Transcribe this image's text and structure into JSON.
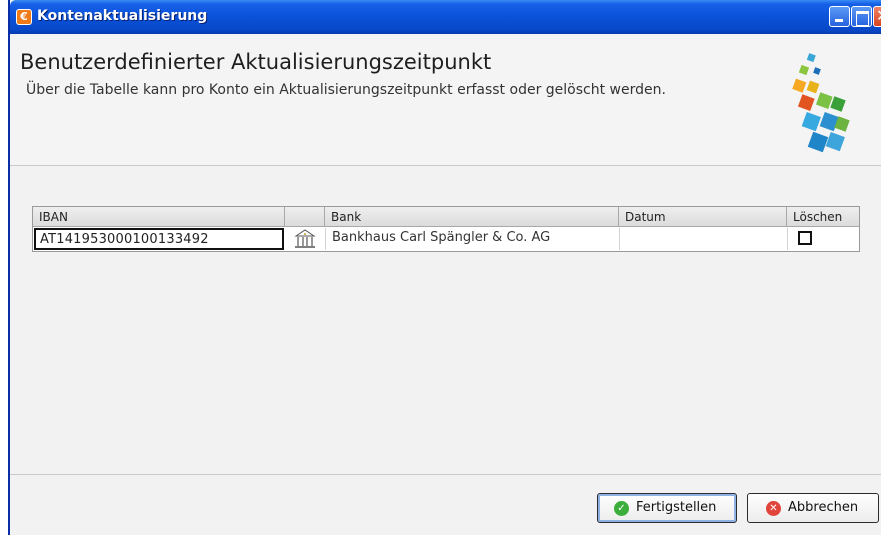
{
  "window": {
    "title": "Kontenaktualisierung",
    "app_icon": "euro-icon",
    "controls": [
      "minimize-icon",
      "maximize-icon",
      "close-icon"
    ]
  },
  "header": {
    "title": "Benutzerdefinierter Aktualisierungszeitpunkt",
    "description": "Über die Tabelle kann pro Konto ein Aktualisierungszeitpunkt erfasst oder gelöscht werden.",
    "decoration_icon": "colored-cubes-icon"
  },
  "table": {
    "columns": [
      "IBAN",
      "",
      "Bank",
      "Datum",
      "Löschen"
    ],
    "rows": [
      {
        "iban": "AT141953000100133492",
        "icon": "bank-building-icon",
        "bank": "Bankhaus Carl Spängler & Co. AG",
        "datum": "",
        "loeschen": false
      }
    ]
  },
  "buttons": {
    "finish_label": "Fertigstellen",
    "finish_icon": "check-circle-icon",
    "cancel_label": "Abbrechen",
    "cancel_icon": "cancel-circle-icon"
  },
  "colors": {
    "titlebar": "#0a52d8",
    "background": "#f2f2f2",
    "ok_icon": "#3cae3c",
    "cancel_icon": "#e0453b"
  }
}
